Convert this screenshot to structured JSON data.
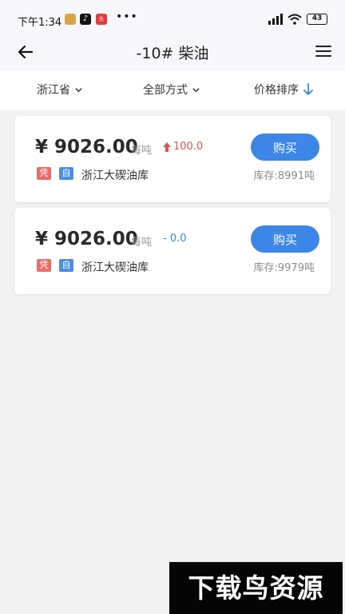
{
  "status_bar": {
    "time": "下午1:34",
    "badges": [
      "",
      "♪",
      "头"
    ],
    "dots": "•••",
    "battery": "43"
  },
  "header": {
    "title": "-10# 柴油"
  },
  "filters": {
    "province": "浙江省",
    "method": "全部方式",
    "sort": "价格排序"
  },
  "listings": [
    {
      "price": "¥ 9026.00",
      "unit": "每吨",
      "change": "100.0",
      "change_direction": "up",
      "tag1": "凭",
      "tag2": "自",
      "depot": "浙江大碶油库",
      "buy_label": "购买",
      "stock": "库存:8991吨"
    },
    {
      "price": "¥ 9026.00",
      "unit": "每吨",
      "change": "- 0.0",
      "change_direction": "flat",
      "tag1": "凭",
      "tag2": "自",
      "depot": "浙江大碶油库",
      "buy_label": "购买",
      "stock": "库存:9979吨"
    }
  ],
  "watermark": "下载鸟资源",
  "colors": {
    "accent": "#3b86e6",
    "up": "#d9534f",
    "flat": "#3d8be0",
    "tag_red": "#ea6b6b",
    "tag_blue": "#4a8fe0"
  }
}
